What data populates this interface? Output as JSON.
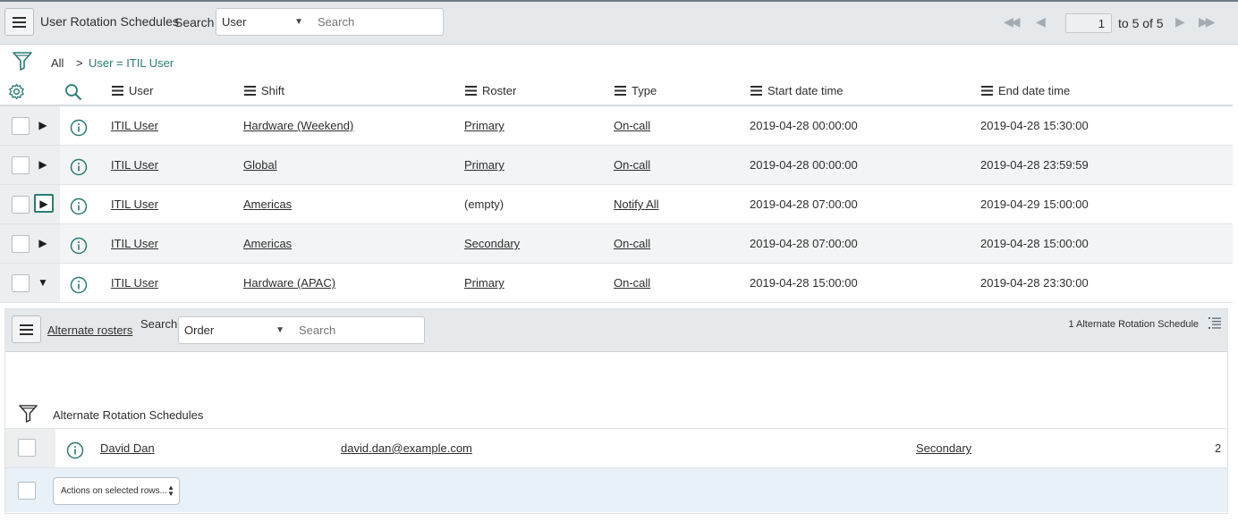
{
  "toolbar": {
    "title": "User Rotation Schedules",
    "search_label": "Search",
    "search_field": "User",
    "search_placeholder": "Search",
    "page_value": "1",
    "page_total_text": "to 5 of 5"
  },
  "breadcrumb": {
    "all": "All",
    "separator": ">",
    "condition": "User = ITIL User"
  },
  "columns": [
    "User",
    "Shift",
    "Roster",
    "Type",
    "Start date time",
    "End date time"
  ],
  "rows": [
    {
      "user": "ITIL User",
      "shift": "Hardware (Weekend)",
      "roster": "Primary",
      "type": "On-call",
      "start": "2019-04-28 00:00:00",
      "end": "2019-04-28 15:30:00",
      "expanded": false
    },
    {
      "user": "ITIL User",
      "shift": "Global",
      "roster": "Primary",
      "type": "On-call",
      "start": "2019-04-28 00:00:00",
      "end": "2019-04-28 23:59:59",
      "expanded": false
    },
    {
      "user": "ITIL User",
      "shift": "Americas",
      "roster": "(empty)",
      "type": "Notify All",
      "start": "2019-04-28 07:00:00",
      "end": "2019-04-29 15:00:00",
      "expanded": false
    },
    {
      "user": "ITIL User",
      "shift": "Americas",
      "roster": "Secondary",
      "type": "On-call",
      "start": "2019-04-28 07:00:00",
      "end": "2019-04-28 15:00:00",
      "expanded": false
    },
    {
      "user": "ITIL User",
      "shift": "Hardware (APAC)",
      "roster": "Primary",
      "type": "On-call",
      "start": "2019-04-28 15:00:00",
      "end": "2019-04-28 23:30:00",
      "expanded": true
    }
  ],
  "related": {
    "title": "Alternate rosters",
    "search_label": "Search",
    "search_field": "Order",
    "search_placeholder": "Search",
    "count_text": "1  Alternate Rotation Schedule",
    "filter_label": "Alternate Rotation Schedules",
    "row": {
      "name": "David Dan",
      "email": "david.dan@example.com",
      "roster": "Secondary",
      "order": "2"
    },
    "actions_label": "Actions on selected rows..."
  },
  "colors": {
    "accent_teal": "#2a7a75",
    "header_bg": "#e6e9eb",
    "row_alt_bg": "#f3f4f5",
    "actions_bg": "#e8f0f8"
  }
}
